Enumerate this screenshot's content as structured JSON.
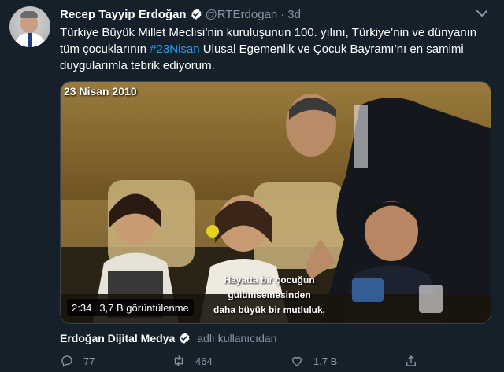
{
  "author": {
    "display_name": "Recep Tayyip Erdoğan",
    "handle": "@RTErdogan",
    "separator": "·",
    "time": "3d"
  },
  "tweet": {
    "text_part1": "Türkiye Büyük Millet Meclisi’nin kuruluşunun 100. yılını, Türkiye’nin ve dünyanın tüm çocuklarının ",
    "hashtag": "#23Nisan",
    "text_part2": " Ulusal Egemenlik ve Çocuk Bayramı’nı en samimi duygularımla tebrik ediyorum."
  },
  "media": {
    "date_overlay": "23 Nisan 2010",
    "subtitle_line1": "Hayatta bir çocuğun gülümsemesinden",
    "subtitle_line2": "daha büyük bir mutluluk,",
    "duration": "2:34",
    "views": "3,7 B görüntülenme"
  },
  "source": {
    "org": "Erdoğan Dijital Medya",
    "extra": "adlı kullanıcıdan"
  },
  "actions": {
    "replies": "77",
    "retweets": "464",
    "likes": "1,7 B"
  },
  "colors": {
    "background": "#15202b",
    "accent": "#1da1f2",
    "secondary_text": "#8899a6"
  },
  "icons": [
    "verified-icon",
    "caret-down-icon",
    "reply-icon",
    "retweet-icon",
    "like-icon",
    "share-icon"
  ]
}
